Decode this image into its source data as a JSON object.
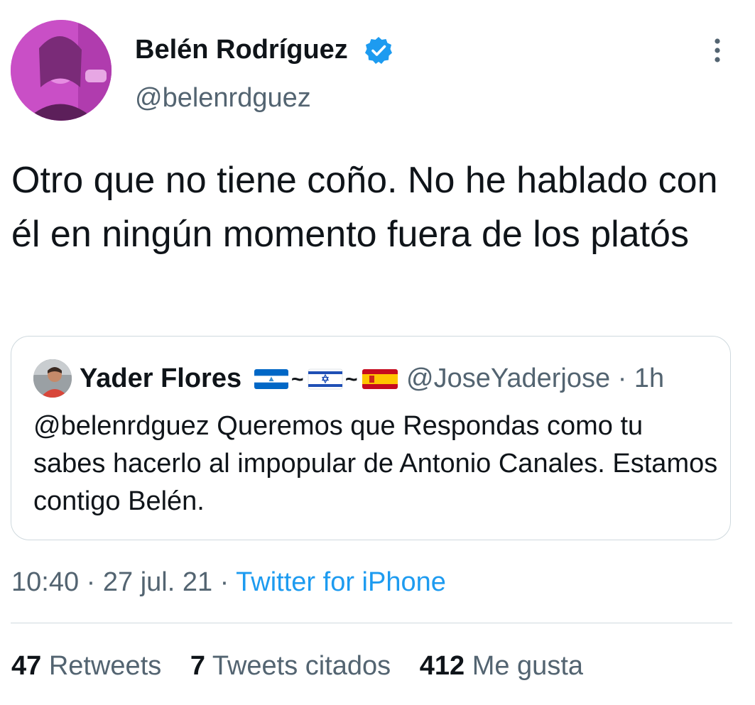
{
  "author": {
    "display_name": "Belén Rodríguez",
    "handle": "@belenrdguez",
    "verified_icon": "verified-badge-icon",
    "avatar_color": "#c94fc6"
  },
  "tweet": {
    "text": "Otro que no tiene coño. No he hablado con él en ningún momento fuera de los platós"
  },
  "quoted_tweet": {
    "display_name": "Yader Flores",
    "name_separator": "~",
    "flags": [
      "flag-nicaragua-icon",
      "flag-israel-icon",
      "flag-spain-icon"
    ],
    "handle_time": "@JoseYaderjose · 1h",
    "text": "@belenrdguez  Queremos que Respondas como tu sabes hacerlo al impopular de Antonio Canales. Estamos contigo Belén."
  },
  "meta": {
    "timestamp": "10:40 · 27 jul. 21 · ",
    "source": "Twitter for iPhone"
  },
  "stats": {
    "retweets_count": "47",
    "retweets_label": "Retweets",
    "quotes_count": "7",
    "quotes_label": "Tweets citados",
    "likes_count": "412",
    "likes_label": "Me gusta"
  },
  "colors": {
    "text_primary": "#0f1419",
    "text_secondary": "#536471",
    "link_blue": "#1d9bf0",
    "border": "#cfd9de"
  }
}
